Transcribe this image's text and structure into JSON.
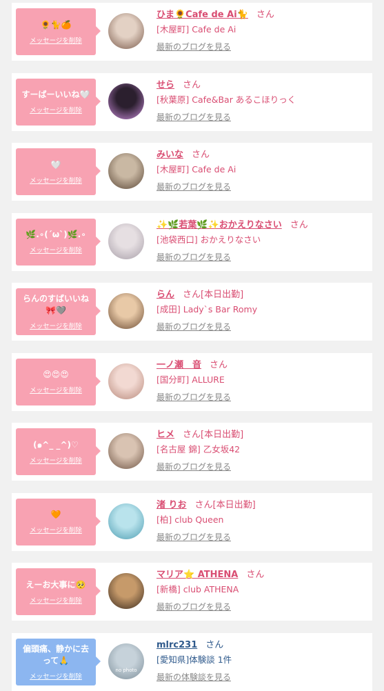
{
  "delete_label": "メッセージを削除",
  "items": [
    {
      "message": "🌻🐈🍊",
      "name": "ひま🌻Cafe de Ai🐈",
      "san": "さん",
      "status": "",
      "shop": "[木屋町] Cafe de Ai",
      "link": "最新のブログを見る",
      "theme": "pink",
      "avatar_colors": [
        "#e3d1c4",
        "#7a5a4b"
      ]
    },
    {
      "message": "すーばーいいね🤍",
      "name": "せら",
      "san": "さん",
      "status": "",
      "shop": "[秋葉原] Cafe&Bar あるこほりっく",
      "link": "最新のブログを見る",
      "theme": "pink",
      "avatar_colors": [
        "#2b1f2e",
        "#c78ad8"
      ]
    },
    {
      "message": "🤍",
      "name": "みいな",
      "san": "さん",
      "status": "",
      "shop": "[木屋町] Cafe de Ai",
      "link": "最新のブログを見る",
      "theme": "pink",
      "avatar_colors": [
        "#c9b8a3",
        "#5a4636"
      ]
    },
    {
      "message": "🌿.∘(ˊωˋ)🌿.∘",
      "name": "✨🌿若葉🌿✨おかえりなさい",
      "san": "さん",
      "status": "",
      "shop": "[池袋西口] おかえりなさい",
      "link": "最新のブログを見る",
      "theme": "pink",
      "avatar_colors": [
        "#e6dfe2",
        "#a79ea8"
      ]
    },
    {
      "message": "らんのすばいいね🎀🩶",
      "name": "らん",
      "san": "さん",
      "status": "[本日出勤]",
      "shop": "[成田] Lady`s Bar Romy",
      "link": "最新のブログを見る",
      "theme": "pink",
      "avatar_colors": [
        "#e8c9a7",
        "#6b4b33"
      ]
    },
    {
      "message": "😍😍😍",
      "name": "一ノ瀬　音",
      "san": "さん",
      "status": "",
      "shop": "[国分町] ALLURE",
      "link": "最新のブログを見る",
      "theme": "pink",
      "avatar_colors": [
        "#f2d9d2",
        "#b88a7c"
      ]
    },
    {
      "message": "(๑^_ _^)♡",
      "name": "ヒメ",
      "san": "さん",
      "status": "[本日出勤]",
      "shop": "[名古屋 錦] 乙女坂42",
      "link": "最新のブログを見る",
      "theme": "pink",
      "avatar_colors": [
        "#d9c3b2",
        "#6e5444"
      ]
    },
    {
      "message": "🧡",
      "name": "渚 りお",
      "san": "さん",
      "status": "[本日出勤]",
      "shop": "[柏] club Queen",
      "link": "最新のブログを見る",
      "theme": "pink",
      "avatar_colors": [
        "#b9e3ec",
        "#4e9db2"
      ]
    },
    {
      "message": "えーお大事に🥺",
      "name": "マリア⭐ ATHENA",
      "san": "さん",
      "status": "",
      "shop": "[新橋] club ATHENA",
      "link": "最新のブログを見る",
      "theme": "pink",
      "avatar_colors": [
        "#c69a6a",
        "#3a2a1e"
      ]
    },
    {
      "message": "偏頭痛、静かに去って🙏",
      "name": "mlrc231",
      "san": "さん",
      "status": "",
      "shop": "[愛知県]体験談 1件",
      "link": "最新の体験談を見る",
      "theme": "blue",
      "avatar_colors": [
        "#c6d2da",
        "#7d8e99"
      ],
      "avatar_text": "no photo"
    }
  ]
}
